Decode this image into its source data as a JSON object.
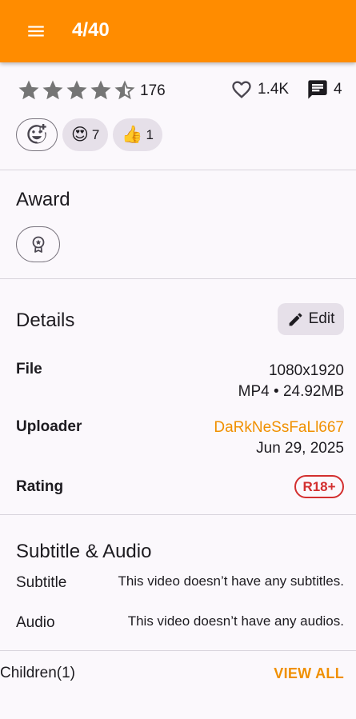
{
  "appbar": {
    "title": "4/40",
    "icon": "menu-icon",
    "color": "#ff8c00"
  },
  "stats": {
    "rating": 4.5,
    "rating_max": 5,
    "rating_count": "176",
    "likes": "1.4K",
    "comments": "4"
  },
  "reactions": [
    {
      "emoji": "😍",
      "count": "7"
    },
    {
      "emoji": "👍",
      "count": "1"
    }
  ],
  "award": {
    "title": "Award",
    "icon": "award-icon"
  },
  "details": {
    "title": "Details",
    "edit_label": "Edit",
    "file_label": "File",
    "file_resolution": "1080x1920",
    "file_format": "MP4 • 24.92MB",
    "uploader_label": "Uploader",
    "uploader_name": "DaRkNeSsFaLl667",
    "upload_date": "Jun 29, 2025",
    "rating_label": "Rating",
    "rating_value": "R18+"
  },
  "subtitle_audio": {
    "title": "Subtitle & Audio",
    "subtitle_label": "Subtitle",
    "subtitle_value": "This video doesn’t have any subtitles.",
    "audio_label": "Audio",
    "audio_value": "This video doesn’t have any audios."
  },
  "children": {
    "label": "Children(1)",
    "view_all": "VIEW ALL"
  },
  "colors": {
    "accent": "#ff8c00",
    "link": "#f09000",
    "danger": "#d32f2f"
  }
}
